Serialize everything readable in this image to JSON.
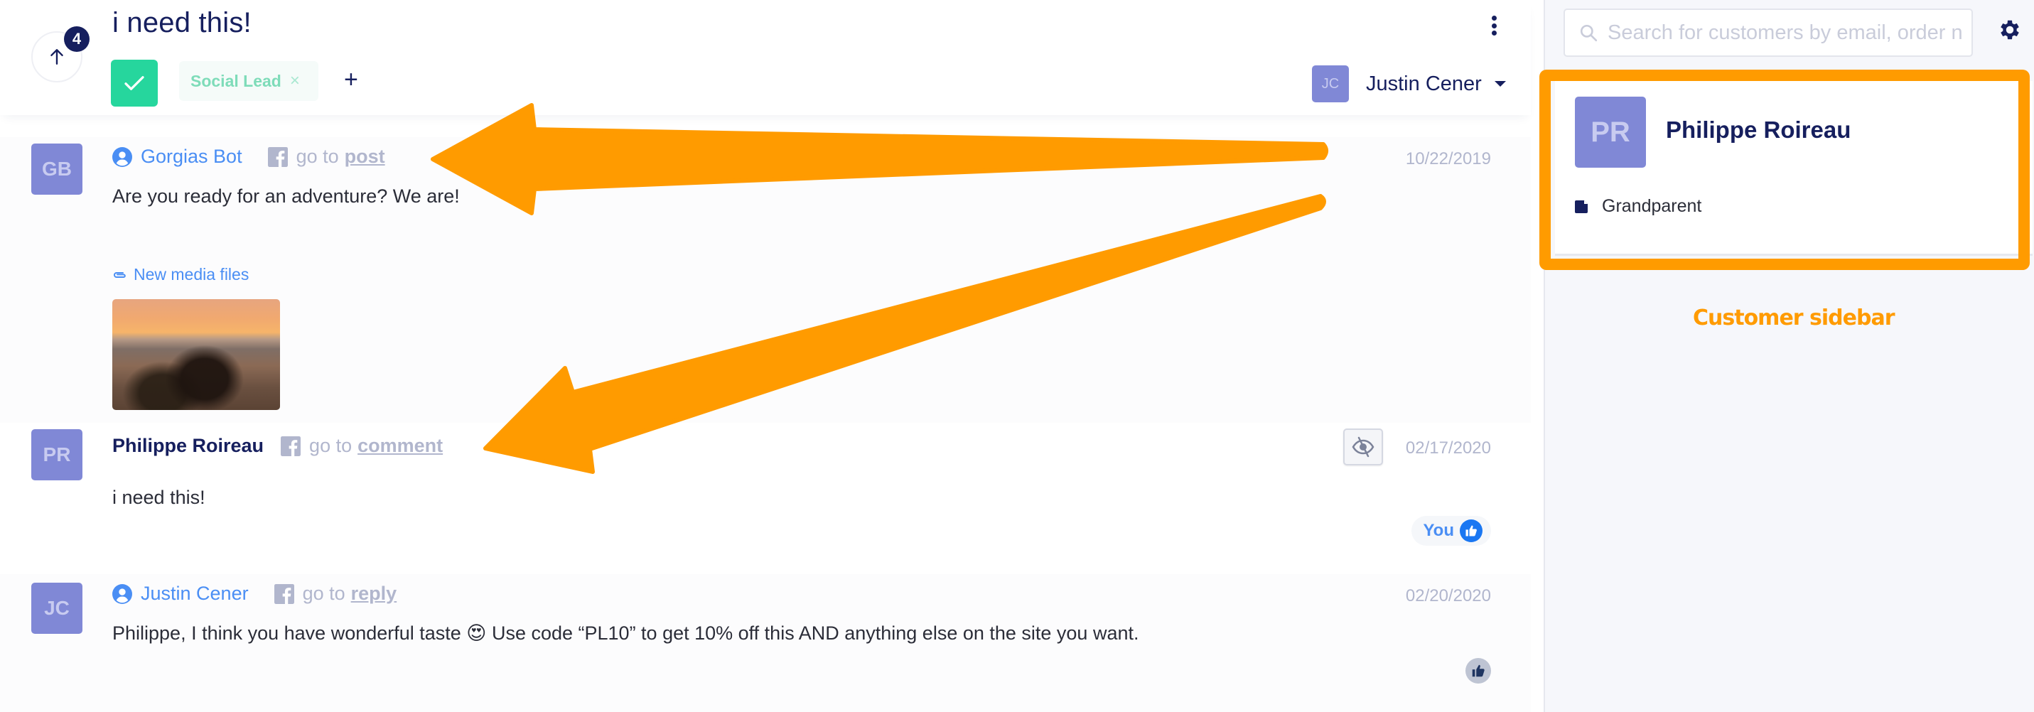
{
  "header": {
    "title": "i need this!",
    "unread_count": "4",
    "back_icon": "arrow-up-icon",
    "status_icon": "check-icon",
    "tags": [
      {
        "label": "Social Lead",
        "remove_glyph": "×"
      }
    ],
    "add_tag_glyph": "+",
    "more_icon": "vertical-dots-icon",
    "assignee": {
      "initials": "JC",
      "name": "Justin Cener"
    }
  },
  "messages": [
    {
      "avatar_initials": "GB",
      "author": "Gorgias Bot",
      "author_icon": "agent-user-icon",
      "source_icon": "facebook-icon",
      "goto_prefix": "go to",
      "goto_link": "post",
      "date": "10/22/2019",
      "body": "Are you ready for an adventure? We are!",
      "attachment_label": "New media files",
      "attachment_icon": "paperclip-icon",
      "attachment_thumbnail": "bikepacking bicycle at sunset"
    },
    {
      "avatar_initials": "PR",
      "author": "Philippe Roireau",
      "source_icon": "facebook-icon",
      "goto_prefix": "go to",
      "goto_link": "comment",
      "date": "02/17/2020",
      "hide_icon": "eye-slash-icon",
      "body": "i need this!",
      "reaction": {
        "label": "You",
        "icon": "thumbs-up-icon"
      }
    },
    {
      "avatar_initials": "JC",
      "author": "Justin Cener",
      "author_icon": "agent-user-icon",
      "source_icon": "facebook-icon",
      "goto_prefix": "go to",
      "goto_link": "reply",
      "date": "02/20/2020",
      "body": "Philippe, I think you have wonderful taste 😍  Use code “PL10” to get 10% off this AND anything else on the site you want.",
      "like_icon": "thumbs-up-icon"
    }
  ],
  "sidebar": {
    "search_placeholder": "Search for customers by email, order number, etc.",
    "search_value": "",
    "settings_icon": "gear-icon",
    "customer": {
      "initials": "PR",
      "name": "Philippe Roireau",
      "note": "Grandparent",
      "note_icon": "note-icon"
    }
  },
  "annotations": {
    "label": "Customer sidebar",
    "color": "#ff9b00"
  },
  "colors": {
    "brand_navy": "#161f5e",
    "agent_blue": "#4a8ef4",
    "success_green": "#26d69d",
    "avatar_purple": "#8088d6",
    "muted_gray": "#b1b6cd",
    "facebook_blue": "#1a77f2"
  }
}
